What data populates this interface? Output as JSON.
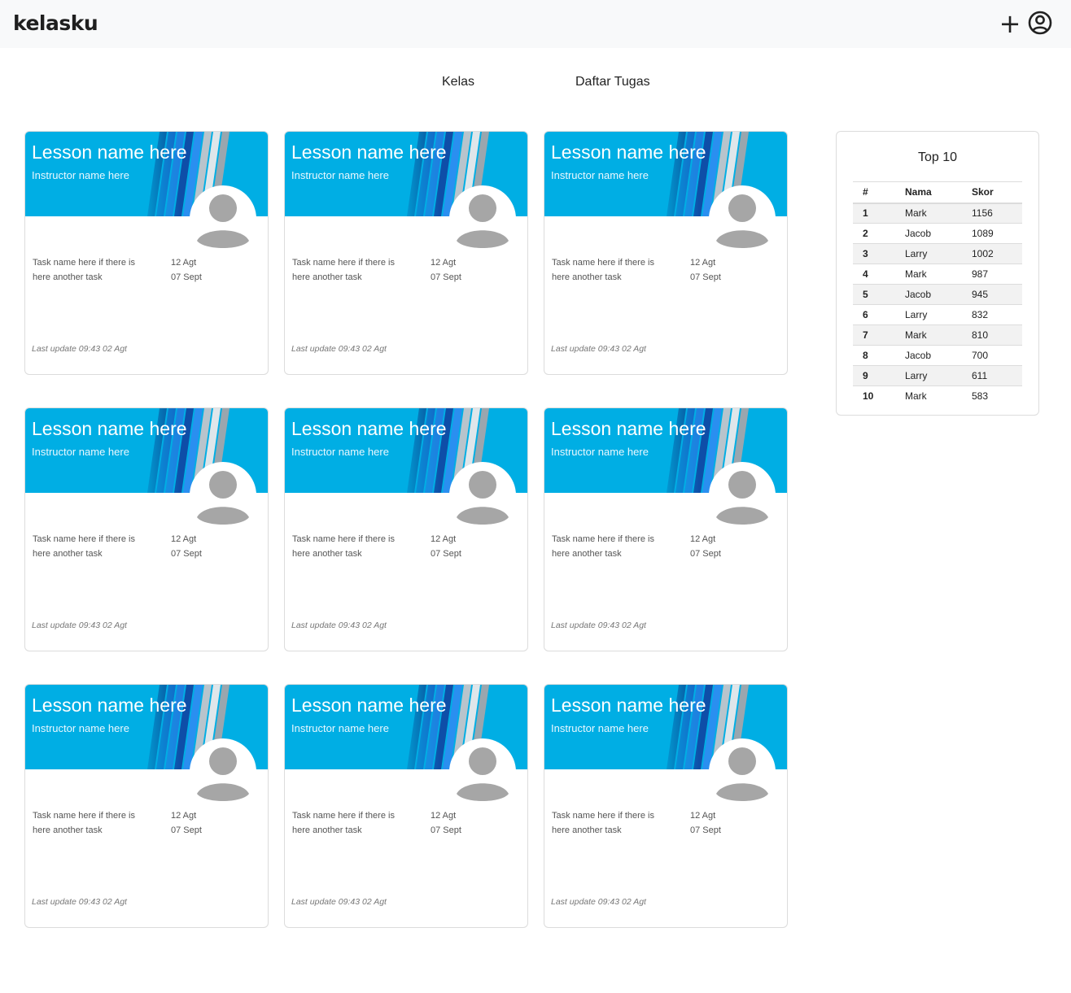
{
  "header": {
    "brand": "kelasku",
    "add_label": "+",
    "account_icon": "account-circle-icon"
  },
  "nav": {
    "tabs": [
      {
        "label": "Kelas"
      },
      {
        "label": "Daftar Tugas"
      }
    ]
  },
  "colors": {
    "banner": "#00aee4",
    "topbar": "#f8f9fa",
    "avatar": "#a6a6a6"
  },
  "cards": [
    {
      "lesson": "Lesson name here",
      "instructor": "Instructor name here",
      "task": "Task name here if there is here another task",
      "date1": "12 Agt",
      "date2": "07 Sept",
      "updated": "Last update 09:43 02 Agt"
    },
    {
      "lesson": "Lesson name here",
      "instructor": "Instructor name here",
      "task": "Task name here if there is here another task",
      "date1": "12 Agt",
      "date2": "07 Sept",
      "updated": "Last update 09:43 02 Agt"
    },
    {
      "lesson": "Lesson name here",
      "instructor": "Instructor name here",
      "task": "Task name here if there is here another task",
      "date1": "12 Agt",
      "date2": "07 Sept",
      "updated": "Last update 09:43 02 Agt"
    },
    {
      "lesson": "Lesson name here",
      "instructor": "Instructor name here",
      "task": "Task name here if there is here another task",
      "date1": "12 Agt",
      "date2": "07 Sept",
      "updated": "Last update 09:43 02 Agt"
    },
    {
      "lesson": "Lesson name here",
      "instructor": "Instructor name here",
      "task": "Task name here if there is here another task",
      "date1": "12 Agt",
      "date2": "07 Sept",
      "updated": "Last update 09:43 02 Agt"
    },
    {
      "lesson": "Lesson name here",
      "instructor": "Instructor name here",
      "task": "Task name here if there is here another task",
      "date1": "12 Agt",
      "date2": "07 Sept",
      "updated": "Last update 09:43 02 Agt"
    },
    {
      "lesson": "Lesson name here",
      "instructor": "Instructor name here",
      "task": "Task name here if there is here another task",
      "date1": "12 Agt",
      "date2": "07 Sept",
      "updated": "Last update 09:43 02 Agt"
    },
    {
      "lesson": "Lesson name here",
      "instructor": "Instructor name here",
      "task": "Task name here if there is here another task",
      "date1": "12 Agt",
      "date2": "07 Sept",
      "updated": "Last update 09:43 02 Agt"
    },
    {
      "lesson": "Lesson name here",
      "instructor": "Instructor name here",
      "task": "Task name here if there is here another task",
      "date1": "12 Agt",
      "date2": "07 Sept",
      "updated": "Last update 09:43 02 Agt"
    }
  ],
  "leaderboard": {
    "title": "Top 10",
    "headers": [
      "#",
      "Nama",
      "Skor"
    ],
    "rows": [
      [
        "1",
        "Mark",
        "1156"
      ],
      [
        "2",
        "Jacob",
        "1089"
      ],
      [
        "3",
        "Larry",
        "1002"
      ],
      [
        "4",
        "Mark",
        "987"
      ],
      [
        "5",
        "Jacob",
        "945"
      ],
      [
        "6",
        "Larry",
        "832"
      ],
      [
        "7",
        "Mark",
        "810"
      ],
      [
        "8",
        "Jacob",
        "700"
      ],
      [
        "9",
        "Larry",
        "611"
      ],
      [
        "10",
        "Mark",
        "583"
      ]
    ]
  }
}
